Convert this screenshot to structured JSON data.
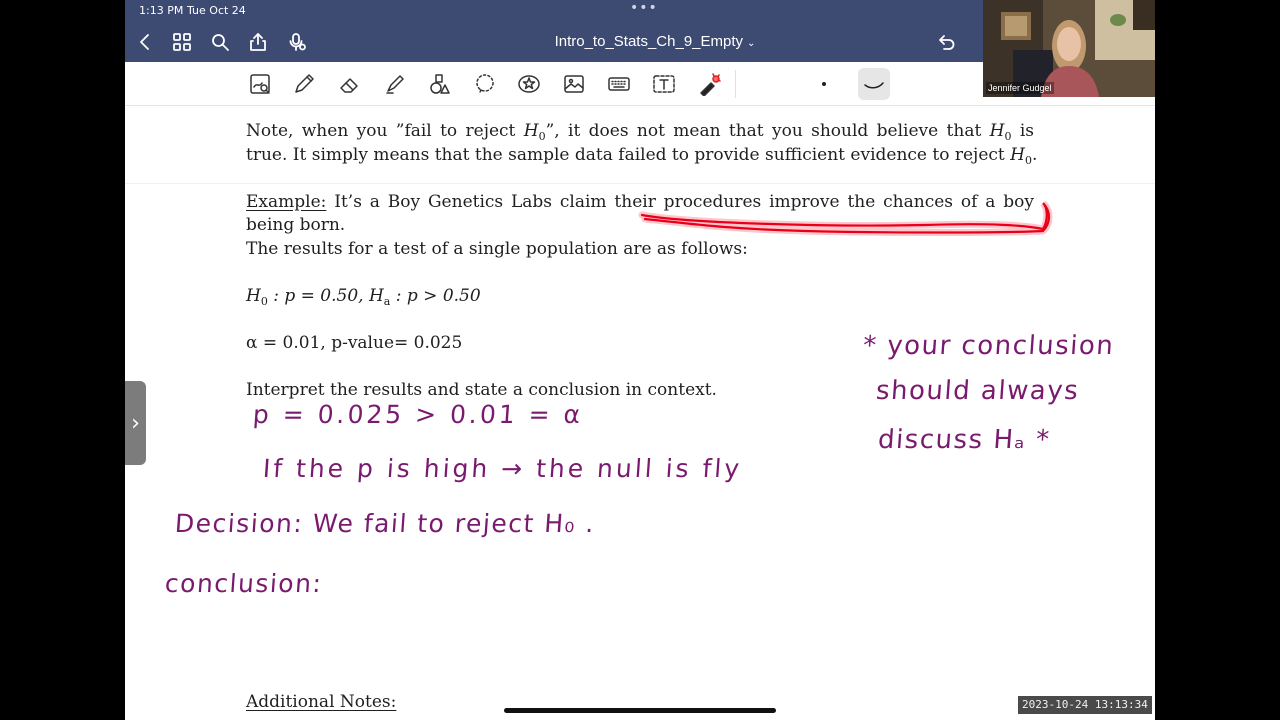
{
  "status_bar": {
    "time": "1:13 PM",
    "date": "Tue Oct 24",
    "multitask_indicator": "•••"
  },
  "nav_bar": {
    "title": "Intro_to_Stats_Ch_9_Empty",
    "title_chevron": "⌄",
    "icons": [
      "back-chevron-icon",
      "grid-view-icon",
      "search-icon",
      "share-icon",
      "microphone-icon",
      "undo-icon"
    ]
  },
  "toolbar": {
    "tools": [
      "document-scan-tool",
      "pen-tool",
      "eraser-tool",
      "highlighter-tool",
      "shapes-tool",
      "lasso-tool",
      "sticker-tool",
      "image-tool",
      "keyboard-tool",
      "text-tool",
      "laser-pointer-tool"
    ],
    "pen_size_dot": "fine",
    "pen_stroke": "curve"
  },
  "document": {
    "note_line1": {
      "a": "Note, when you ”fail to reject ",
      "h": "H",
      "h_sub": "0",
      "b": "”, it does not mean that you should believe that ",
      "h2": "H",
      "h2_sub": "0",
      "c": " is"
    },
    "note_line2": {
      "a": "true. It simply means that the sample data failed to provide sufficient evidence to reject ",
      "h": "H",
      "h_sub": "0",
      "b": "."
    },
    "example_label": "Example:",
    "example_line1": " It’s a Boy Genetics Labs claim their procedures improve the chances of a boy",
    "example_line2": "being born.",
    "results_line": "The results for a test of a single population are as follows:",
    "hyp": {
      "h0": "H",
      "h0_sub": "0",
      "h0_rest": " : p = 0.50, ",
      "ha": "H",
      "ha_sub": "a",
      "ha_rest": " : p > 0.50"
    },
    "alpha_line": "α = 0.01, p-value= 0.025",
    "interpret_line": "Interpret the results and state a conclusion in context.",
    "additional_notes": "Additional Notes:"
  },
  "handwriting": {
    "compare": "p = 0.025 > 0.01 = α",
    "rule": "If the p is high → the null is fly",
    "decision": "Decision: We fail to reject H₀ .",
    "conclusion": "conclusion:",
    "side_note_1": "* your conclusion",
    "side_note_2": "should always",
    "side_note_3": "discuss Hₐ *"
  },
  "colors": {
    "nav_bar": "#3d4a72",
    "ink_purple": "#7a1a6e",
    "highlight_red": "#e8001a"
  },
  "side_tab": {
    "icon": "›"
  },
  "webcam": {
    "participant_name": "Jennifer Gudgel"
  },
  "recording_timestamp": "2023-10-24 13:13:34"
}
